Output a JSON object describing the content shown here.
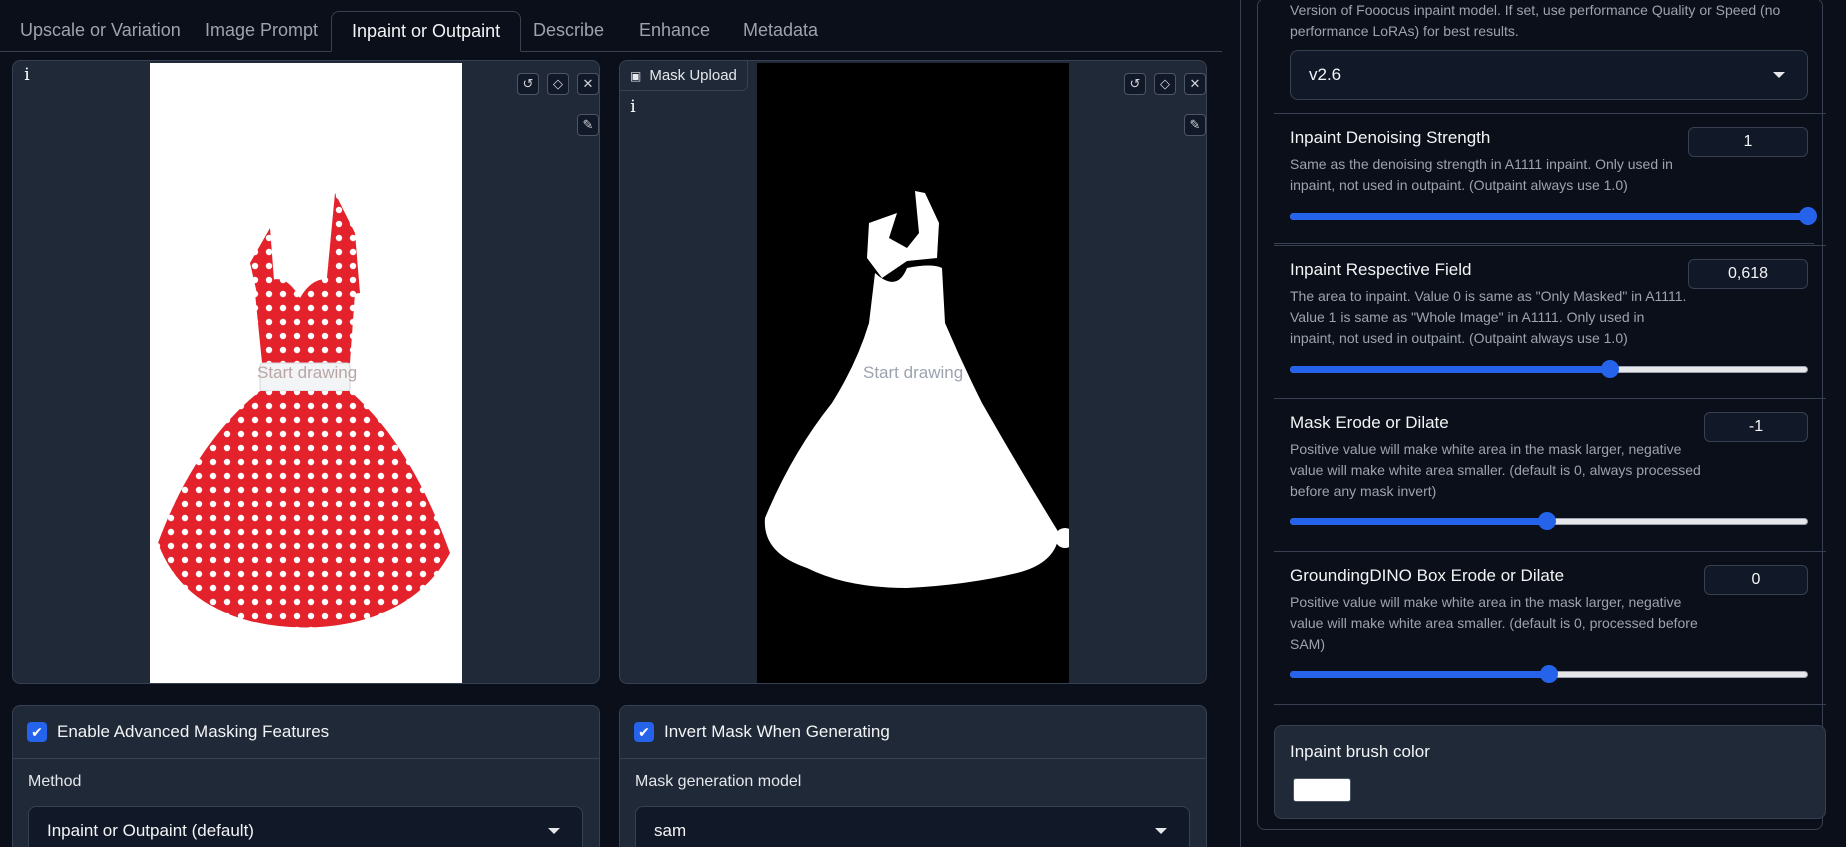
{
  "tabs": [
    {
      "label": "Upscale or Variation"
    },
    {
      "label": "Image Prompt"
    },
    {
      "label": "Inpaint or Outpaint"
    },
    {
      "label": "Describe"
    },
    {
      "label": "Enhance"
    },
    {
      "label": "Metadata"
    }
  ],
  "image_panel": {
    "info_label": "i",
    "placeholder": "Start drawing"
  },
  "mask_panel": {
    "tab_label": "Mask Upload",
    "info_label": "i",
    "placeholder": "Start drawing"
  },
  "advanced": {
    "enable_label": "Enable Advanced Masking Features",
    "enabled": true,
    "method_label": "Method",
    "method_value": "Inpaint or Outpaint (default)"
  },
  "mask_options": {
    "invert_label": "Invert Mask When Generating",
    "invert_enabled": true,
    "model_label": "Mask generation model",
    "model_value": "sam"
  },
  "settings": {
    "engine_desc": "Version of Fooocus inpaint model. If set, use performance Quality or Speed (no performance LoRAs) for best results.",
    "engine_value": "v2.6",
    "denoise": {
      "title": "Inpaint Denoising Strength",
      "desc": "Same as the denoising strength in A1111 inpaint. Only used in inpaint, not used in outpaint. (Outpaint always use 1.0)",
      "value": "1",
      "fraction": 1.0
    },
    "respective": {
      "title": "Inpaint Respective Field",
      "desc": "The area to inpaint. Value 0 is same as \"Only Masked\" in A1111. Value 1 is same as \"Whole Image\" in A1111. Only used in inpaint, not used in outpaint. (Outpaint always use 1.0)",
      "value": "0,618",
      "fraction": 0.618
    },
    "erode": {
      "title": "Mask Erode or Dilate",
      "desc": "Positive value will make white area in the mask larger, negative value will make white area smaller. (default is 0, always processed before any mask invert)",
      "value": "-1",
      "fraction": 0.497
    },
    "dino": {
      "title": "GroundingDINO Box Erode or Dilate",
      "desc": "Positive value will make white area in the mask larger, negative value will make white area smaller. (default is 0, processed before SAM)",
      "value": "0",
      "fraction": 0.5
    },
    "brush": {
      "title": "Inpaint brush color",
      "color": "#ffffff"
    }
  },
  "colors": {
    "accent": "#2563eb",
    "dress_red": "#e3222b"
  }
}
